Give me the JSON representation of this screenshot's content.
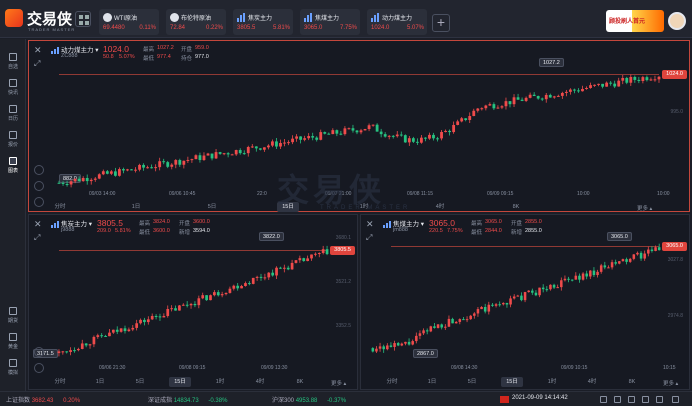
{
  "app": {
    "brand": "交易侠",
    "brand_sub": "TRADER MASTER"
  },
  "tickers": [
    {
      "name": "WTI原油",
      "price": "69.4480",
      "change": "0.11%",
      "icon": "oil-icon"
    },
    {
      "name": "布伦特原油",
      "price": "72.84",
      "change": "0.22%",
      "icon": "oil-icon"
    },
    {
      "name": "焦炭主力",
      "price": "3805.5",
      "change": "5.81%",
      "icon": "bar-chart-icon"
    },
    {
      "name": "焦煤主力",
      "price": "3065.0",
      "change": "7.75%",
      "icon": "bar-chart-icon"
    },
    {
      "name": "动力煤主力",
      "price": "1024.0",
      "change": "5.07%",
      "icon": "bar-chart-icon"
    }
  ],
  "promo": {
    "text": "顾投刷人首元"
  },
  "sidebar": [
    {
      "label": "自选",
      "icon": "star-list-icon"
    },
    {
      "label": "快讯",
      "icon": "news-icon"
    },
    {
      "label": "日历",
      "icon": "calendar-icon"
    },
    {
      "label": "报价",
      "icon": "quote-icon"
    },
    {
      "label": "图表",
      "icon": "chart-icon",
      "active": true
    },
    {
      "label": "期货",
      "icon": "futures-icon"
    },
    {
      "label": "黄金",
      "icon": "gold-icon"
    },
    {
      "label": "模拟",
      "icon": "simulation-icon"
    }
  ],
  "watermark": {
    "text": "交易侠",
    "sub": "TRADER MASTER"
  },
  "panels": {
    "main": {
      "name": "动力煤主力 ▾",
      "code": "ZC888",
      "price": "1024.0",
      "change": "50.8",
      "change_pct": "5.07%",
      "high_lbl": "最高",
      "high": "1027.2",
      "open_lbl": "开盘",
      "open": "959.0",
      "low_lbl": "最低",
      "low": "977.4",
      "oi_lbl": "持仓",
      "oi": "977.0",
      "tag": "1024.0",
      "peak": "1027.2",
      "trough": "882.0",
      "y_mid": "995.0",
      "xlabels": [
        "09/03 14:00",
        "09/06 10:45",
        "22:0",
        "09/07 21:00",
        "09/08 11:15",
        "09/09 09:15",
        "10:00",
        "10:00"
      ],
      "periods": [
        "分时",
        "1日",
        "5日",
        "15日",
        "1时",
        "4时",
        "8K"
      ],
      "active_period": 3,
      "more": "更多 ▴"
    },
    "bl": {
      "name": "焦炭主力 ▾",
      "code": "j9888",
      "price": "3805.5",
      "change": "209.0",
      "change_pct": "5.81%",
      "high_lbl": "最高",
      "high": "3824.0",
      "open_lbl": "开盘",
      "open": "3600.0",
      "low_lbl": "最低",
      "low": "3600.0",
      "oi_lbl": "新增",
      "oi": "3594.0",
      "tag": "3805.5",
      "peak": "3822.0",
      "trough": "3171.5",
      "y1": "3680.1",
      "y2": "3521.2",
      "y3": "3352.5",
      "xlabels": [
        "09/06 21:30",
        "09/08 09:15",
        "09/09 13:30"
      ],
      "periods": [
        "分时",
        "1日",
        "5日",
        "15日",
        "1时",
        "4时",
        "8K"
      ],
      "active_period": 3,
      "more": "更多 ▴"
    },
    "br": {
      "name": "焦煤主力 ▾",
      "code": "jm888",
      "price": "3065.0",
      "change": "220.5",
      "change_pct": "7.75%",
      "high_lbl": "最高",
      "high": "3065.0",
      "open_lbl": "开盘",
      "open": "2855.0",
      "low_lbl": "最低",
      "low": "2844.0",
      "oi_lbl": "新增",
      "oi": "2855.0",
      "tag": "3065.0",
      "peak": "3065.0",
      "trough": "2867.0",
      "y1": "3027.8",
      "y2": "2974.8",
      "xlabels": [
        "09/08 14:30",
        "09/09 10:15",
        "10:15"
      ],
      "periods": [
        "分时",
        "1日",
        "5日",
        "15日",
        "1时",
        "4时",
        "8K"
      ],
      "active_period": 3,
      "more": "更多 ▴"
    }
  },
  "statusbar": [
    {
      "label": "上证指数",
      "value": "3682.43",
      "pct": "0.20%",
      "color": "red"
    },
    {
      "label": "深证成指",
      "value": "14834.73",
      "pct": "-0.38%",
      "color": "grn"
    },
    {
      "label": "沪深300",
      "value": "4953.88",
      "pct": "-0.37%",
      "color": "grn"
    }
  ],
  "datetime": "2021-09-09 14:14:42",
  "colors": {
    "up": "#ef4b4b",
    "down": "#26c281",
    "accent": "#e0453d",
    "bg": "#161922"
  }
}
